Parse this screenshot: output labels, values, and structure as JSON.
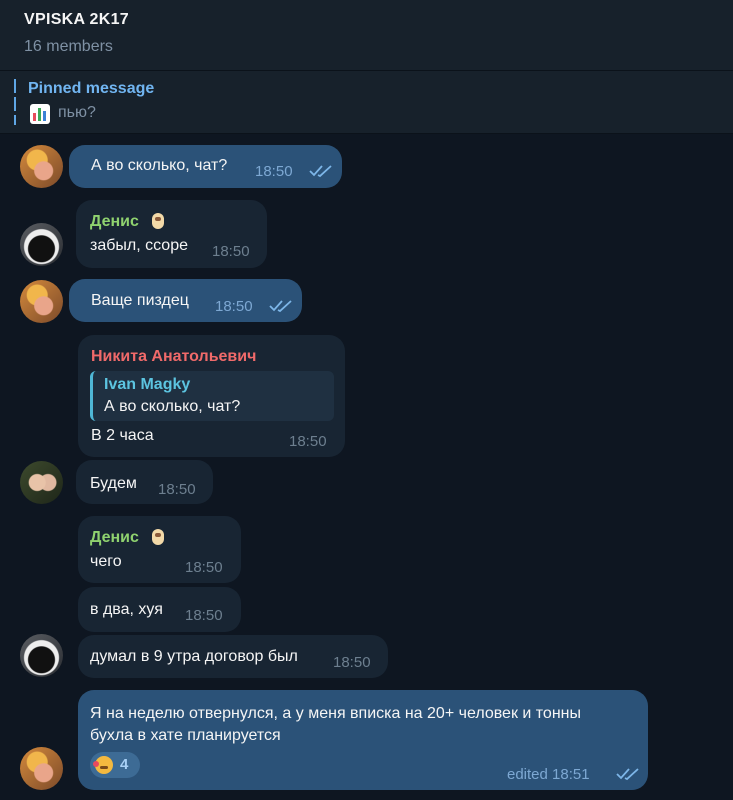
{
  "header": {
    "title": "VPISKA 2K17",
    "subtitle": "16 members"
  },
  "pinned": {
    "title": "Pinned message",
    "text": "пью?",
    "icon": "bar-chart-icon"
  },
  "messages": [
    {
      "text": "А во сколько, чат?",
      "time": "18:50",
      "outgoing": true,
      "read": true
    },
    {
      "sender": "Денис",
      "text": "забыл, ссоре",
      "time": "18:50",
      "sender_icon": "cat-sticker-icon"
    },
    {
      "text": "Ваще пиздец",
      "time": "18:50",
      "outgoing": true,
      "read": true
    },
    {
      "sender": "Никита Анатольевич",
      "reply_to": {
        "name": "Ivan Magky",
        "text": "А во сколько, чат?"
      },
      "text": "В 2 часа",
      "time": "18:50"
    },
    {
      "text": "Будем",
      "time": "18:50"
    },
    {
      "sender": "Денис",
      "text": "чего",
      "time": "18:50",
      "sender_icon": "cat-sticker-icon"
    },
    {
      "text": "в два, хуя",
      "time": "18:50"
    },
    {
      "text": "думал в 9 утра договор был",
      "time": "18:50"
    },
    {
      "text_line1": "Я на неделю отвернулся, а у меня вписка на 20+ человек и тонны",
      "text_line2": "бухла в хате планируется",
      "time": "edited 18:51",
      "outgoing": true,
      "read": true,
      "reaction": {
        "emoji": "smiling-face-with-hearts-icon",
        "count": "4"
      }
    }
  ],
  "colors": {
    "background": "#0e1621",
    "incoming": "#182533",
    "outgoing": "#2b5278",
    "accent": "#71b5f1"
  }
}
